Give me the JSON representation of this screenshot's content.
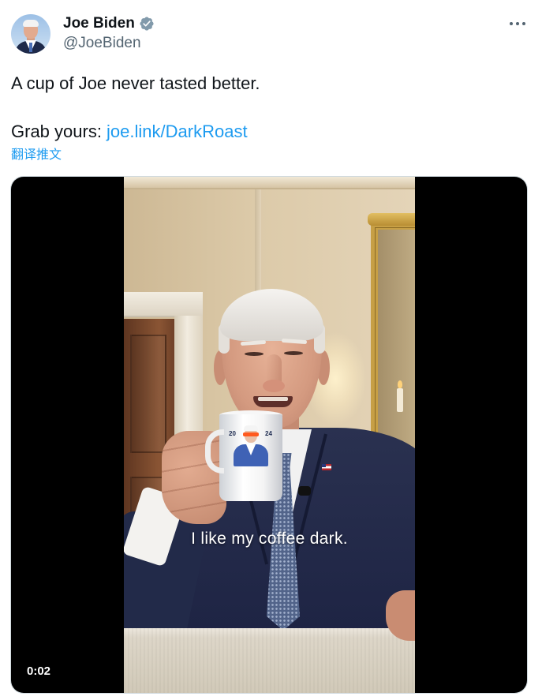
{
  "colors": {
    "text": "#0f1419",
    "secondary": "#536471",
    "link": "#1d9bf0",
    "badge": "#829aab",
    "video_bg": "#000000"
  },
  "author": {
    "name": "Joe Biden",
    "handle": "@JoeBiden",
    "verified": true,
    "avatar_icon": "avatar-photo",
    "badge_icon": "verified-badge-icon"
  },
  "header": {
    "more_icon": "more-options-icon"
  },
  "tweet": {
    "line1": "A cup of Joe never tasted better.",
    "line2_prefix": "Grab yours: ",
    "link_text": "joe.link/DarkRoast",
    "translate_label": "翻译推文"
  },
  "video": {
    "caption": "I like my coffee dark.",
    "timestamp": "0:02",
    "mug_text_left": "20",
    "mug_text_right": "24"
  }
}
